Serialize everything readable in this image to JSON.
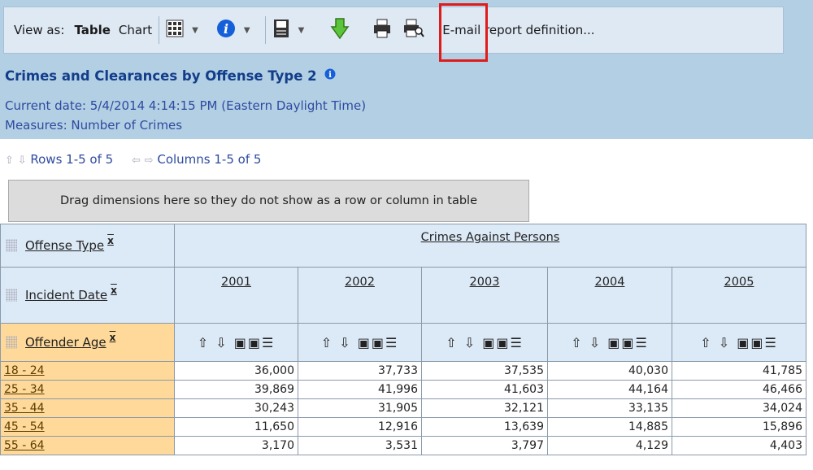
{
  "toolbar": {
    "view_as_label": "View as:",
    "table_label": "Table",
    "chart_label": "Chart",
    "email_label": "E-mail report definition..."
  },
  "report": {
    "title": "Crimes and Clearances by Offense Type 2",
    "current_date": "Current date: 5/4/2014 4:14:15 PM (Eastern Daylight Time)",
    "measures": "Measures: Number of Crimes"
  },
  "nav": {
    "rows_text": "Rows 1-5 of 5",
    "columns_text": "Columns 1-5 of 5"
  },
  "drag_zone": {
    "text": "Drag dimensions here so they do not show as a row or column in table"
  },
  "dimensions": {
    "offense_type": "Offense Type",
    "incident_date": "Incident Date",
    "offender_age": "Offender Age"
  },
  "table": {
    "group_header": "Crimes Against Persons",
    "years": [
      "2001",
      "2002",
      "2003",
      "2004",
      "2005"
    ],
    "sort_icons": "⇧⇩☐☐☰",
    "rows": [
      {
        "label": "18 - 24",
        "values": [
          "36,000",
          "37,733",
          "37,535",
          "40,030",
          "41,785"
        ]
      },
      {
        "label": "25 - 34",
        "values": [
          "39,869",
          "41,996",
          "41,603",
          "44,164",
          "46,466"
        ]
      },
      {
        "label": "35 - 44",
        "values": [
          "30,243",
          "31,905",
          "32,121",
          "33,135",
          "34,024"
        ]
      },
      {
        "label": "45 - 54",
        "values": [
          "11,650",
          "12,916",
          "13,639",
          "14,885",
          "15,896"
        ]
      },
      {
        "label": "55 - 64",
        "values": [
          "3,170",
          "3,531",
          "3,797",
          "4,129",
          "4,403"
        ]
      }
    ]
  },
  "colors": {
    "header_band": "#b3cfe3",
    "title_blue": "#123d8a",
    "highlight_red": "#e01b1b",
    "row_label_bg": "#ffd999",
    "header_cell_bg": "#dce9f6"
  }
}
